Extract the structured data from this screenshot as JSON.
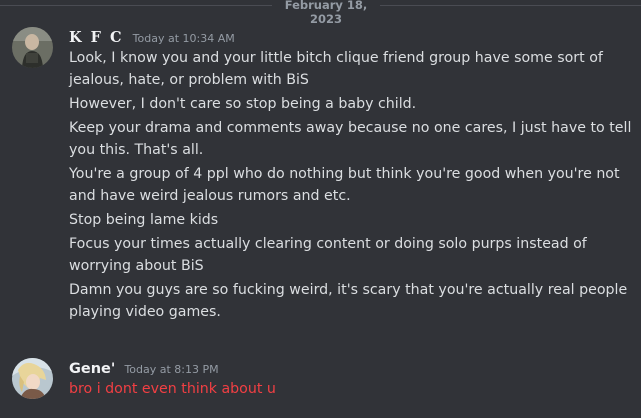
{
  "date_divider": "February 18, 2023",
  "messages": [
    {
      "author": "K F C",
      "timestamp": "Today at 10:34 AM",
      "paragraphs": [
        [
          "Look, I know you and your little bitch clique friend group have some sort of",
          "jealous, hate, or problem with BiS"
        ],
        [
          "However, I don't care so stop being a baby child."
        ],
        [
          "Keep your drama and comments away because no one cares, I just have to tell",
          "you this. That's all."
        ],
        [
          "You're a group of 4 ppl who do nothing but think you're good when you're not",
          "and have weird jealous rumors and etc."
        ],
        [
          "Stop being lame kids"
        ],
        [
          "Focus your times actually clearing content or doing solo purps instead of",
          "worrying about BiS"
        ],
        [
          "Damn you guys are so fucking weird, it's scary that you're actually real people",
          "playing video games."
        ]
      ]
    },
    {
      "author": "Gene'",
      "timestamp": "Today at 8:13 PM",
      "text": "bro i dont even think about u",
      "text_color": "#f23f43"
    }
  ],
  "colors": {
    "background": "#313338",
    "text": "#dbdee1",
    "muted": "#949ba4",
    "username": "#f2f3f5"
  }
}
